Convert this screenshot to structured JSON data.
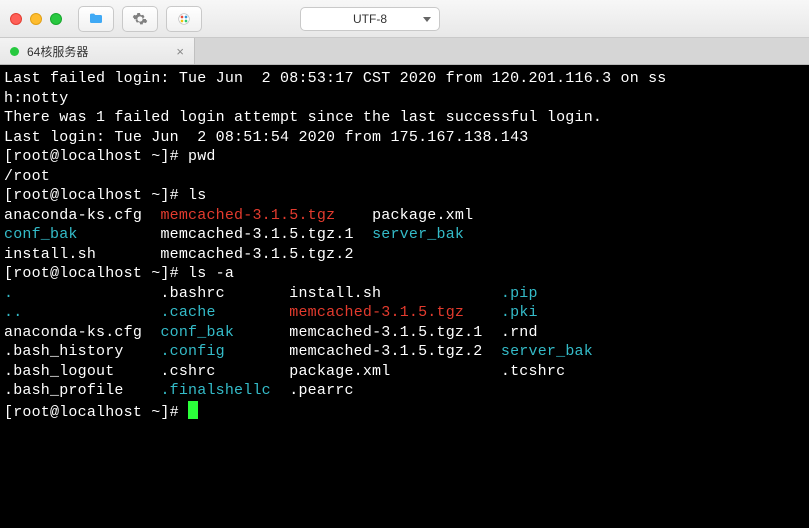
{
  "titlebar": {
    "encoding": "UTF-8"
  },
  "tab": {
    "title": "64核服务器",
    "close": "×"
  },
  "lines": [
    [
      {
        "t": "Last failed login: Tue Jun  2 08:53:17 CST 2020 from 120.201.116.3 on ss",
        "c": "c-white"
      }
    ],
    [
      {
        "t": "h:notty",
        "c": "c-white"
      }
    ],
    [
      {
        "t": "There was 1 failed login attempt since the last successful login.",
        "c": "c-white"
      }
    ],
    [
      {
        "t": "Last login: Tue Jun  2 08:51:54 2020 from 175.167.138.143",
        "c": "c-white"
      }
    ],
    [
      {
        "t": "[root@localhost ~]# pwd",
        "c": "c-white"
      }
    ],
    [
      {
        "t": "/root",
        "c": "c-white"
      }
    ],
    [
      {
        "t": "[root@localhost ~]# ls",
        "c": "c-white"
      }
    ],
    [
      {
        "t": "anaconda-ks.cfg  ",
        "c": "c-white"
      },
      {
        "t": "memcached-3.1.5.tgz",
        "c": "c-red"
      },
      {
        "t": "    package.xml",
        "c": "c-white"
      }
    ],
    [
      {
        "t": "conf_bak",
        "c": "c-cyan"
      },
      {
        "t": "         memcached-3.1.5.tgz.1  ",
        "c": "c-white"
      },
      {
        "t": "server_bak",
        "c": "c-cyan"
      }
    ],
    [
      {
        "t": "install.sh       memcached-3.1.5.tgz.2",
        "c": "c-white"
      }
    ],
    [
      {
        "t": "[root@localhost ~]# ls -a",
        "c": "c-white"
      }
    ],
    [
      {
        "t": ".",
        "c": "c-cyan"
      },
      {
        "t": "                .bashrc       install.sh             ",
        "c": "c-white"
      },
      {
        "t": ".pip",
        "c": "c-cyan"
      }
    ],
    [
      {
        "t": "..",
        "c": "c-cyan"
      },
      {
        "t": "               ",
        "c": "c-white"
      },
      {
        "t": ".cache",
        "c": "c-cyan"
      },
      {
        "t": "        ",
        "c": "c-white"
      },
      {
        "t": "memcached-3.1.5.tgz",
        "c": "c-red"
      },
      {
        "t": "    ",
        "c": "c-white"
      },
      {
        "t": ".pki",
        "c": "c-cyan"
      }
    ],
    [
      {
        "t": "anaconda-ks.cfg  ",
        "c": "c-white"
      },
      {
        "t": "conf_bak",
        "c": "c-cyan"
      },
      {
        "t": "      memcached-3.1.5.tgz.1  .rnd",
        "c": "c-white"
      }
    ],
    [
      {
        "t": ".bash_history    ",
        "c": "c-white"
      },
      {
        "t": ".config",
        "c": "c-cyan"
      },
      {
        "t": "       memcached-3.1.5.tgz.2  ",
        "c": "c-white"
      },
      {
        "t": "server_bak",
        "c": "c-cyan"
      }
    ],
    [
      {
        "t": ".bash_logout     .cshrc        package.xml            .tcshrc",
        "c": "c-white"
      }
    ],
    [
      {
        "t": ".bash_profile    ",
        "c": "c-white"
      },
      {
        "t": ".finalshellc",
        "c": "c-cyan"
      },
      {
        "t": "  .pearrc",
        "c": "c-white"
      }
    ],
    [
      {
        "t": "[root@localhost ~]# ",
        "c": "c-white"
      }
    ]
  ]
}
